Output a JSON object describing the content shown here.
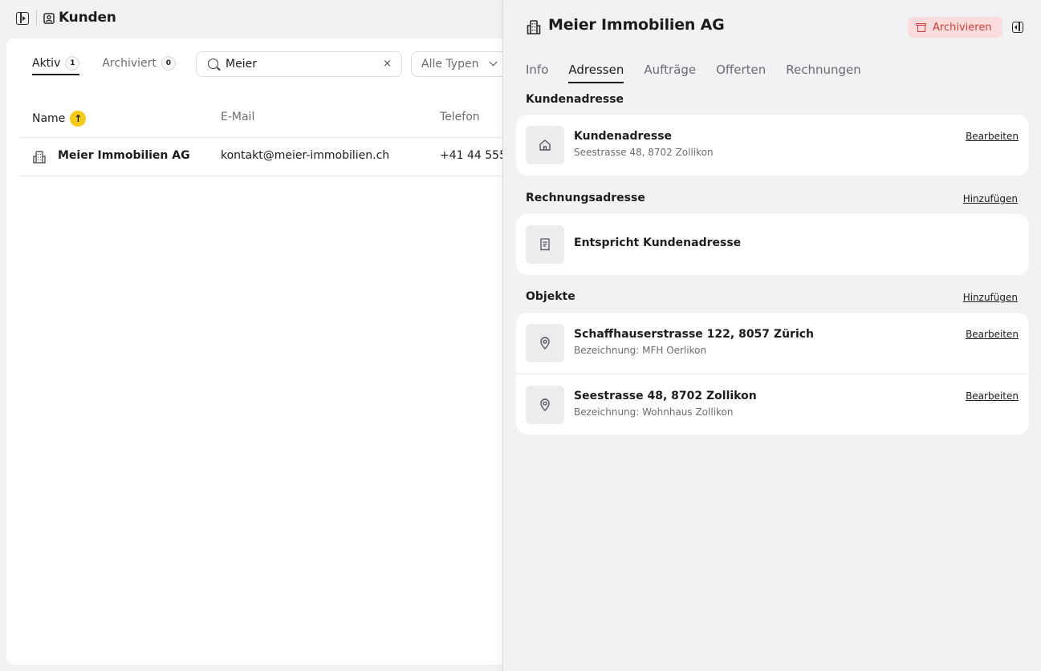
{
  "header": {
    "title": "Kunden"
  },
  "list": {
    "tabs": [
      {
        "label": "Aktiv",
        "count": "1"
      },
      {
        "label": "Archiviert",
        "count": "0"
      }
    ],
    "search": {
      "value": "Meier",
      "clear_symbol": "×"
    },
    "type_filter": {
      "label": "Alle Typen"
    },
    "columns": {
      "name": "Name",
      "email": "E-Mail",
      "phone": "Telefon"
    },
    "sort_symbol": "↑",
    "rows": [
      {
        "name": "Meier Immobilien AG",
        "email": "kontakt@meier-immobilien.ch",
        "phone": "+41 44 555"
      }
    ]
  },
  "detail": {
    "title": "Meier Immobilien AG",
    "archive_label": "Archivieren",
    "tabs": [
      "Info",
      "Adressen",
      "Aufträge",
      "Offerten",
      "Rechnungen"
    ],
    "active_tab": "Adressen",
    "customer_address": {
      "section_title": "Kundenadresse",
      "item_title": "Kundenadresse",
      "item_sub": "Seestrasse 48, 8702 Zollikon",
      "edit_label": "Bearbeiten"
    },
    "billing_address": {
      "section_title": "Rechnungsadresse",
      "add_label": "Hinzufügen",
      "item_title": "Entspricht Kundenadresse"
    },
    "objects": {
      "section_title": "Objekte",
      "add_label": "Hinzufügen",
      "items": [
        {
          "title": "Schaffhauserstrasse 122, 8057 Zürich",
          "sub": "Bezeichnung: MFH Oerlikon",
          "edit_label": "Bearbeiten"
        },
        {
          "title": "Seestrasse 48, 8702 Zollikon",
          "sub": "Bezeichnung: Wohnhaus Zollikon",
          "edit_label": "Bearbeiten"
        }
      ]
    }
  },
  "colors": {
    "accent_yellow": "#f4cb1b",
    "archive_bg": "#fbdcdc",
    "archive_text": "#d23b3b",
    "panel_bg": "#f2f2f4"
  },
  "icons": [
    "sidebar-toggle-icon",
    "contact-icon",
    "building-icon",
    "search-icon",
    "clear-icon",
    "chevron-down-icon",
    "archive-icon",
    "close-panel-icon",
    "home-icon",
    "receipt-icon",
    "map-pin-icon"
  ]
}
